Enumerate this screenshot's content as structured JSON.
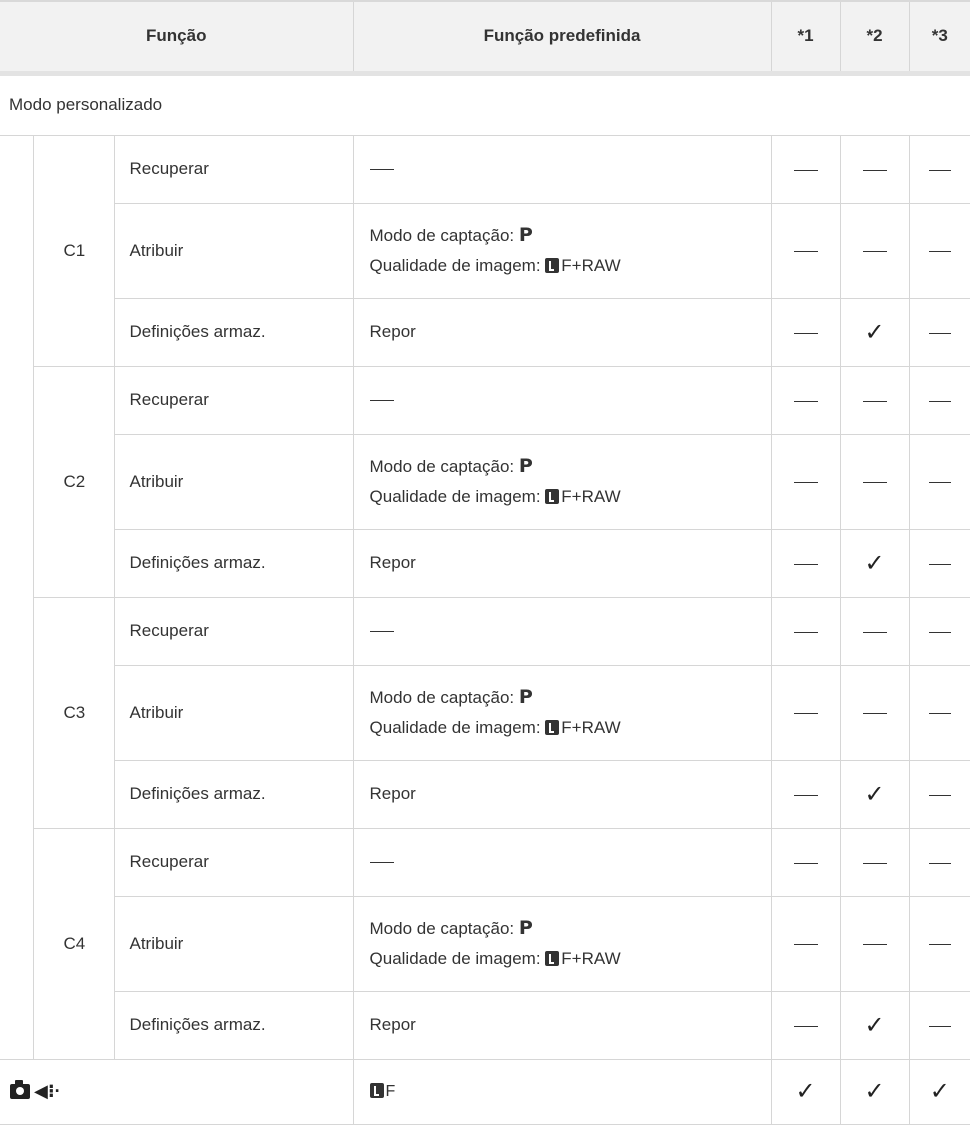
{
  "header": {
    "col_function": "Função",
    "col_default": "Função predefinida",
    "col_1": "*1",
    "col_2": "*2",
    "col_3": "*3"
  },
  "section_title": "Modo personalizado",
  "groups": [
    {
      "label": "C1",
      "rows": [
        {
          "function": "Recuperar",
          "default": "—",
          "marks": [
            "—",
            "—",
            "—"
          ]
        },
        {
          "function": "Atribuir",
          "default_line1": "Modo de captação:",
          "default_line1_bold": "P",
          "default_line2": "Qualidade de imagem:",
          "default_line2_suffix": "F+RAW",
          "marks": [
            "—",
            "—",
            "—"
          ]
        },
        {
          "function": "Definições armaz.",
          "default": "Repor",
          "marks": [
            "—",
            "✓",
            "—"
          ]
        }
      ]
    },
    {
      "label": "C2",
      "rows": [
        {
          "function": "Recuperar",
          "default": "—",
          "marks": [
            "—",
            "—",
            "—"
          ]
        },
        {
          "function": "Atribuir",
          "default_line1": "Modo de captação:",
          "default_line1_bold": "P",
          "default_line2": "Qualidade de imagem:",
          "default_line2_suffix": "F+RAW",
          "marks": [
            "—",
            "—",
            "—"
          ]
        },
        {
          "function": "Definições armaz.",
          "default": "Repor",
          "marks": [
            "—",
            "✓",
            "—"
          ]
        }
      ]
    },
    {
      "label": "C3",
      "rows": [
        {
          "function": "Recuperar",
          "default": "—",
          "marks": [
            "—",
            "—",
            "—"
          ]
        },
        {
          "function": "Atribuir",
          "default_line1": "Modo de captação:",
          "default_line1_bold": "P",
          "default_line2": "Qualidade de imagem:",
          "default_line2_suffix": "F+RAW",
          "marks": [
            "—",
            "—",
            "—"
          ]
        },
        {
          "function": "Definições armaz.",
          "default": "Repor",
          "marks": [
            "—",
            "✓",
            "—"
          ]
        }
      ]
    },
    {
      "label": "C4",
      "rows": [
        {
          "function": "Recuperar",
          "default": "—",
          "marks": [
            "—",
            "—",
            "—"
          ]
        },
        {
          "function": "Atribuir",
          "default_line1": "Modo de captação:",
          "default_line1_bold": "P",
          "default_line2": "Qualidade de imagem:",
          "default_line2_suffix": "F+RAW",
          "marks": [
            "—",
            "—",
            "—"
          ]
        },
        {
          "function": "Definições armaz.",
          "default": "Repor",
          "marks": [
            "—",
            "✓",
            "—"
          ]
        }
      ]
    }
  ],
  "final_row": {
    "icons": [
      "camera-icon",
      "drive-mode-icon"
    ],
    "default_suffix": "F",
    "marks": [
      "✓",
      "✓",
      "✓"
    ]
  }
}
